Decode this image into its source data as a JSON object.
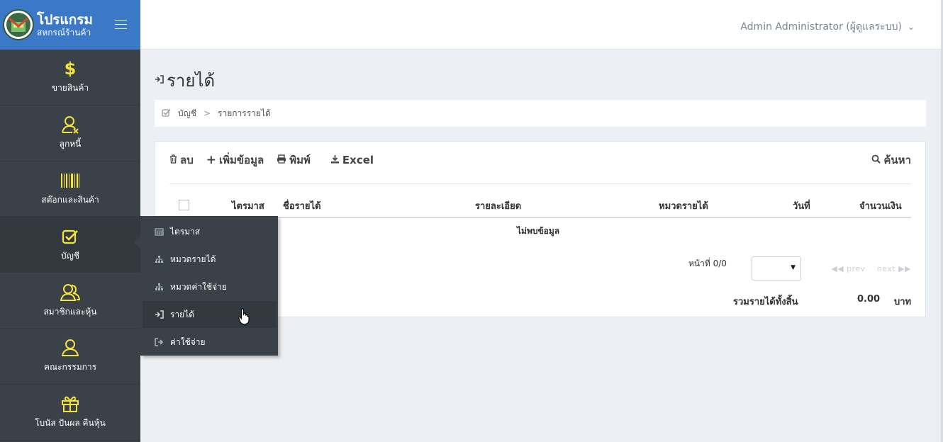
{
  "brand": {
    "title": "โปรแกรม",
    "subtitle": "สหกรณ์ร้านค้า"
  },
  "sidebar": {
    "items": [
      {
        "label": "ขายสินค้า",
        "icon": "dollar-icon"
      },
      {
        "label": "ลูกหนี้",
        "icon": "user-x-icon"
      },
      {
        "label": "สต๊อกและสินค้า",
        "icon": "barcode-icon"
      },
      {
        "label": "บัญชี",
        "icon": "checkbox-icon"
      },
      {
        "label": "สมาชิกและหุ้น",
        "icon": "users-icon"
      },
      {
        "label": "คณะกรรมการ",
        "icon": "user-icon"
      },
      {
        "label": "โบนัส ปันผล คืนหุ้น",
        "icon": "gift-icon"
      }
    ]
  },
  "submenu": {
    "items": [
      {
        "label": "ไตรมาส",
        "icon": "calendar-icon"
      },
      {
        "label": "หมวดรายได้",
        "icon": "sitemap-icon"
      },
      {
        "label": "หมวดค่าใช้จ่าย",
        "icon": "sitemap-icon"
      },
      {
        "label": "รายได้",
        "icon": "sign-in-icon"
      },
      {
        "label": "ค่าใช้จ่าย",
        "icon": "sign-out-icon"
      }
    ]
  },
  "header": {
    "user": "Admin Administrator (ผู้ดูแลระบบ)"
  },
  "page": {
    "title": "รายได้"
  },
  "breadcrumb": {
    "root": "บัญชี",
    "current": "รายการรายได้"
  },
  "toolbar": {
    "delete": "ลบ",
    "add": "เพิ่มข้อมูล",
    "print": "พิมพ์",
    "excel": "Excel",
    "search": "ค้นหา"
  },
  "table": {
    "columns": [
      "ไตรมาส",
      "ชื่อรายได้",
      "รายละเอียด",
      "หมวดรายได้",
      "วันที่",
      "จำนวนเงิน"
    ],
    "empty": "ไม่พบข้อมูล"
  },
  "pager": {
    "page_text": "หน้าที่ 0/0",
    "prev": "prev",
    "next": "next"
  },
  "summary": {
    "label": "รวมรายได้ทั้งสิ้น",
    "amount": "0.00",
    "unit": "บาท"
  },
  "colors": {
    "brand": "#3c78c8",
    "sidebar": "#3a4148",
    "icon_yellow": "#f5e23c"
  }
}
